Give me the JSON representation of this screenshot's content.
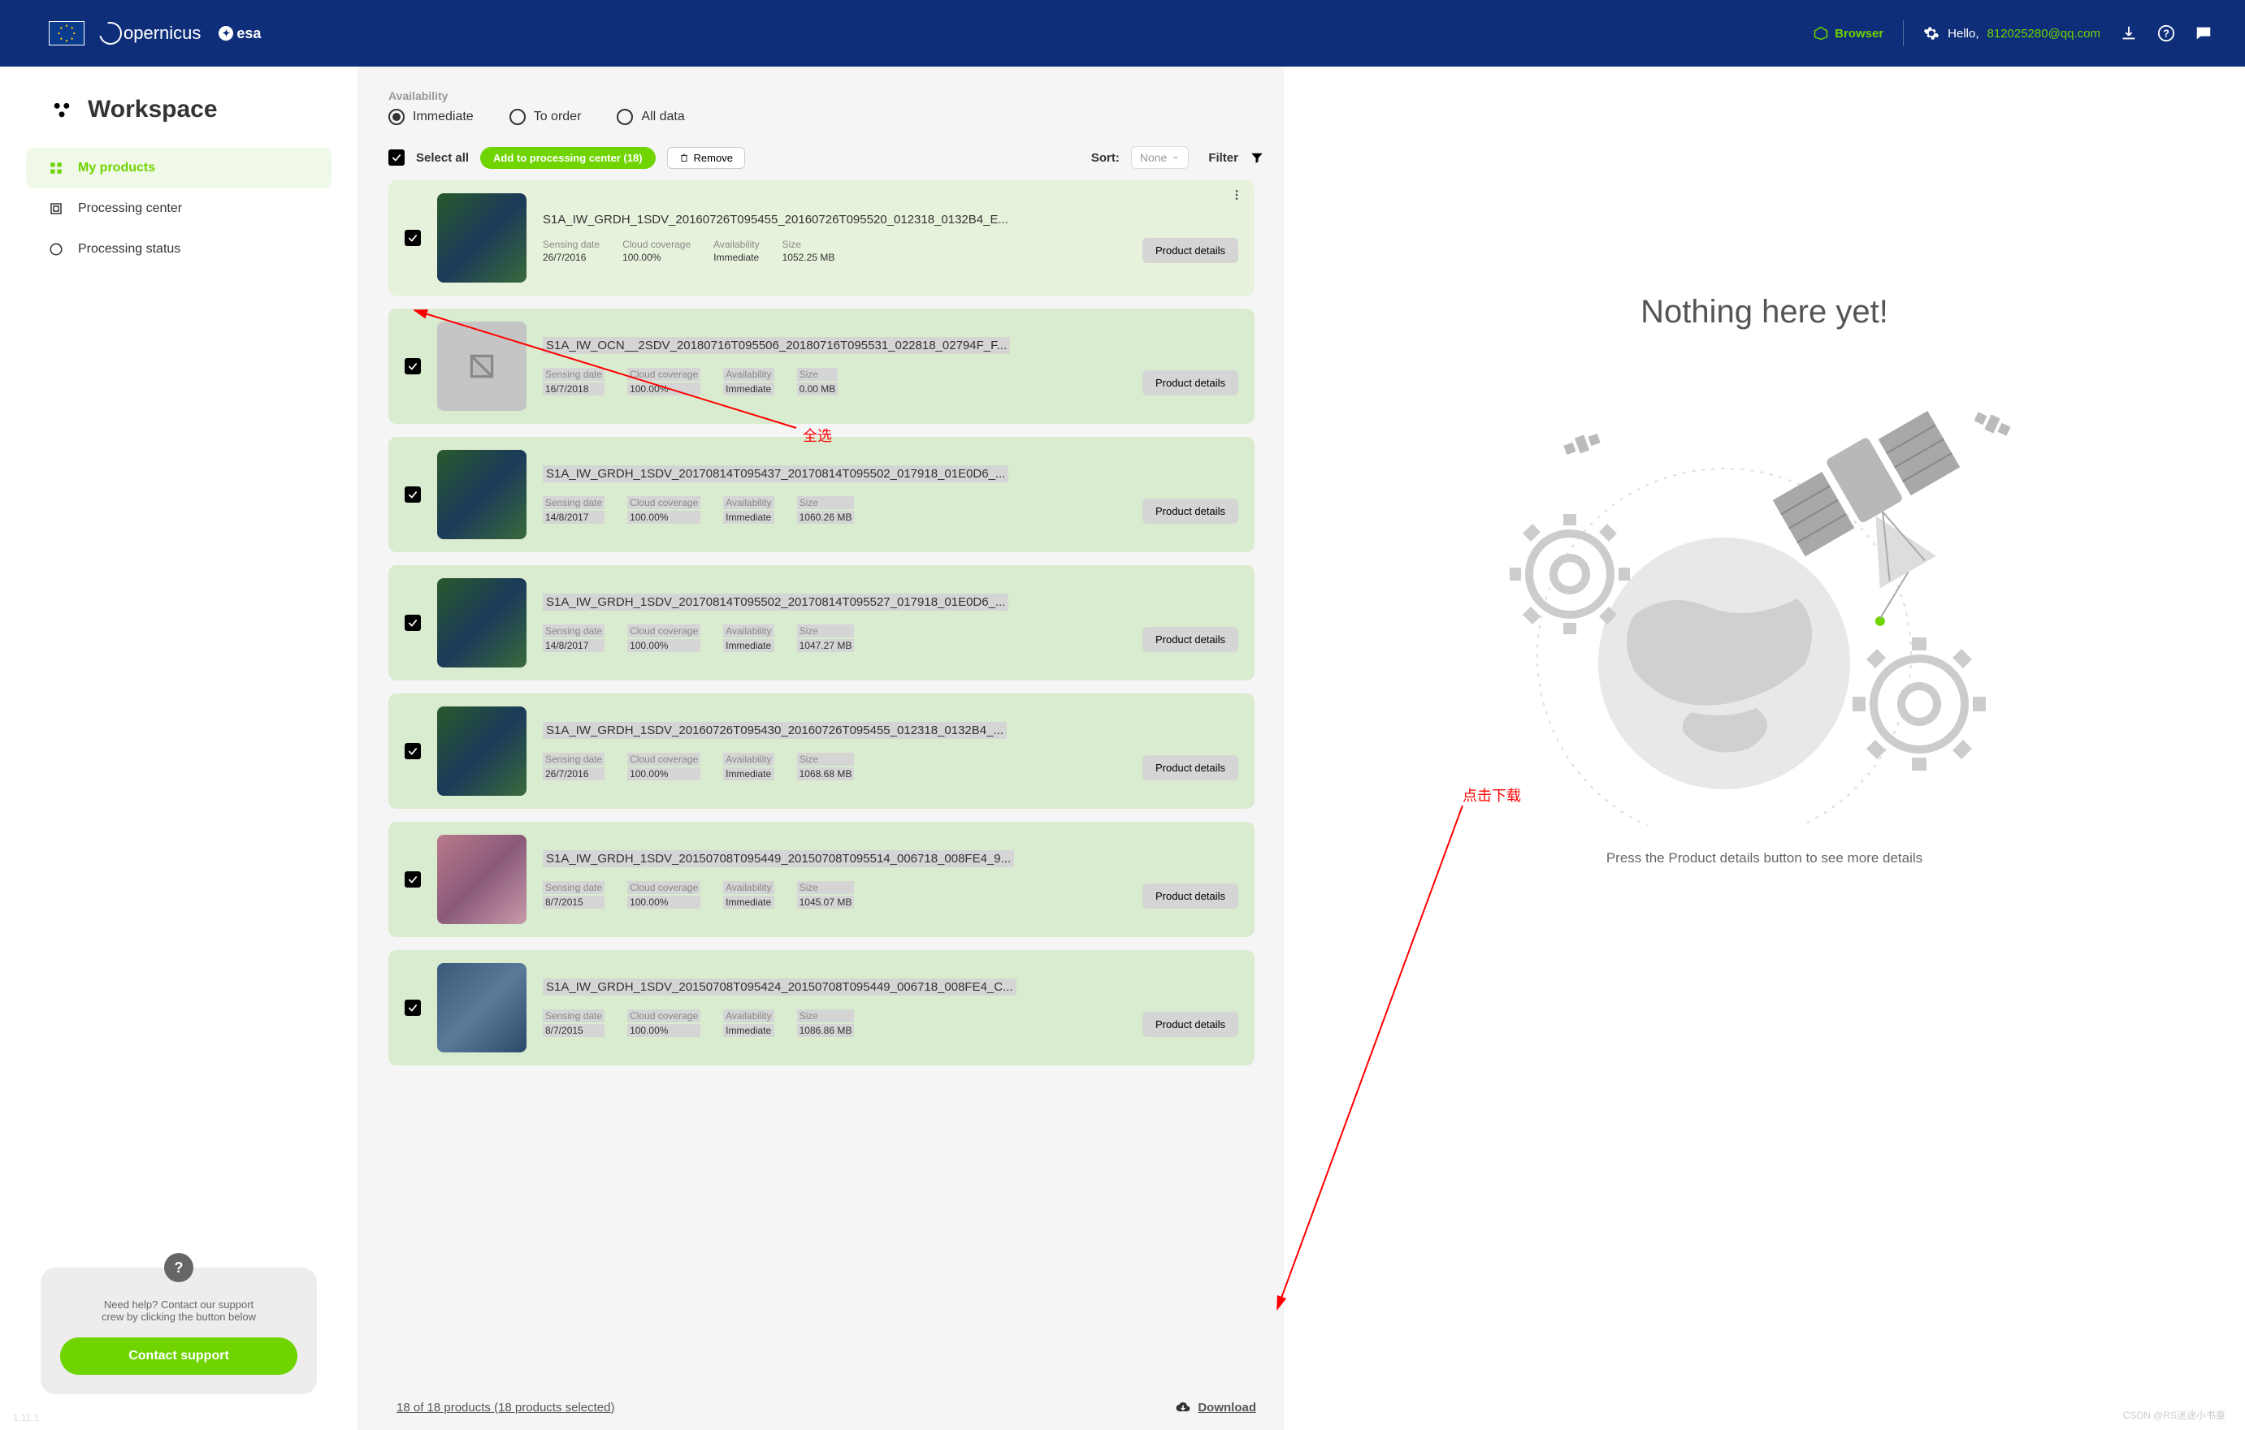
{
  "header": {
    "copernicus": "opernicus",
    "esa": "esa",
    "browser": "Browser",
    "hello_prefix": "Hello, ",
    "email": "812025280@qq.com"
  },
  "sidebar": {
    "title": "Workspace",
    "nav": [
      {
        "label": "My products",
        "active": true
      },
      {
        "label": "Processing center",
        "active": false
      },
      {
        "label": "Processing status",
        "active": false
      }
    ],
    "support_text1": "Need help? Contact our support",
    "support_text2": "crew by clicking the button below",
    "support_btn": "Contact support",
    "version": "1.11.1"
  },
  "center": {
    "availability_label": "Availability",
    "radios": [
      {
        "label": "Immediate",
        "checked": true
      },
      {
        "label": "To order",
        "checked": false
      },
      {
        "label": "All data",
        "checked": false
      }
    ],
    "select_all": "Select all",
    "add_btn": "Add to processing center (18)",
    "remove_btn": "Remove",
    "sort_label": "Sort:",
    "sort_value": "None",
    "filter_label": "Filter",
    "meta_labels": {
      "sensing": "Sensing date",
      "cloud": "Cloud coverage",
      "avail": "Availability",
      "size": "Size"
    },
    "details_btn": "Product details",
    "products": [
      {
        "title": "S1A_IW_GRDH_1SDV_20160726T095455_20160726T095520_012318_0132B4_E...",
        "sensing": "26/7/2016",
        "cloud": "100.00%",
        "avail": "Immediate",
        "size": "1052.25 MB",
        "hl": false,
        "thumb": "sat"
      },
      {
        "title": "S1A_IW_OCN__2SDV_20180716T095506_20180716T095531_022818_02794F_F...",
        "sensing": "16/7/2018",
        "cloud": "100.00%",
        "avail": "Immediate",
        "size": "0.00 MB",
        "hl": true,
        "thumb": "noimg"
      },
      {
        "title": "S1A_IW_GRDH_1SDV_20170814T095437_20170814T095502_017918_01E0D6_...",
        "sensing": "14/8/2017",
        "cloud": "100.00%",
        "avail": "Immediate",
        "size": "1060.26 MB",
        "hl": true,
        "thumb": "sat"
      },
      {
        "title": "S1A_IW_GRDH_1SDV_20170814T095502_20170814T095527_017918_01E0D6_...",
        "sensing": "14/8/2017",
        "cloud": "100.00%",
        "avail": "Immediate",
        "size": "1047.27 MB",
        "hl": true,
        "thumb": "sat"
      },
      {
        "title": "S1A_IW_GRDH_1SDV_20160726T095430_20160726T095455_012318_0132B4_...",
        "sensing": "26/7/2016",
        "cloud": "100.00%",
        "avail": "Immediate",
        "size": "1068.68 MB",
        "hl": true,
        "thumb": "sat"
      },
      {
        "title": "S1A_IW_GRDH_1SDV_20150708T095449_20150708T095514_006718_008FE4_9...",
        "sensing": "8/7/2015",
        "cloud": "100.00%",
        "avail": "Immediate",
        "size": "1045.07 MB",
        "hl": true,
        "thumb": "pink"
      },
      {
        "title": "S1A_IW_GRDH_1SDV_20150708T095424_20150708T095449_006718_008FE4_C...",
        "sensing": "8/7/2015",
        "cloud": "100.00%",
        "avail": "Immediate",
        "size": "1086.86 MB",
        "hl": true,
        "thumb": "blue"
      }
    ],
    "footer_count": "18 of 18 products (18 products selected)",
    "download": "Download"
  },
  "detail": {
    "title": "Nothing here yet!",
    "hint": "Press the Product details button to see more details",
    "watermark": "CSDN @RS迷途小书童"
  },
  "annotations": {
    "a1": "全选",
    "a2": "点击下载"
  }
}
